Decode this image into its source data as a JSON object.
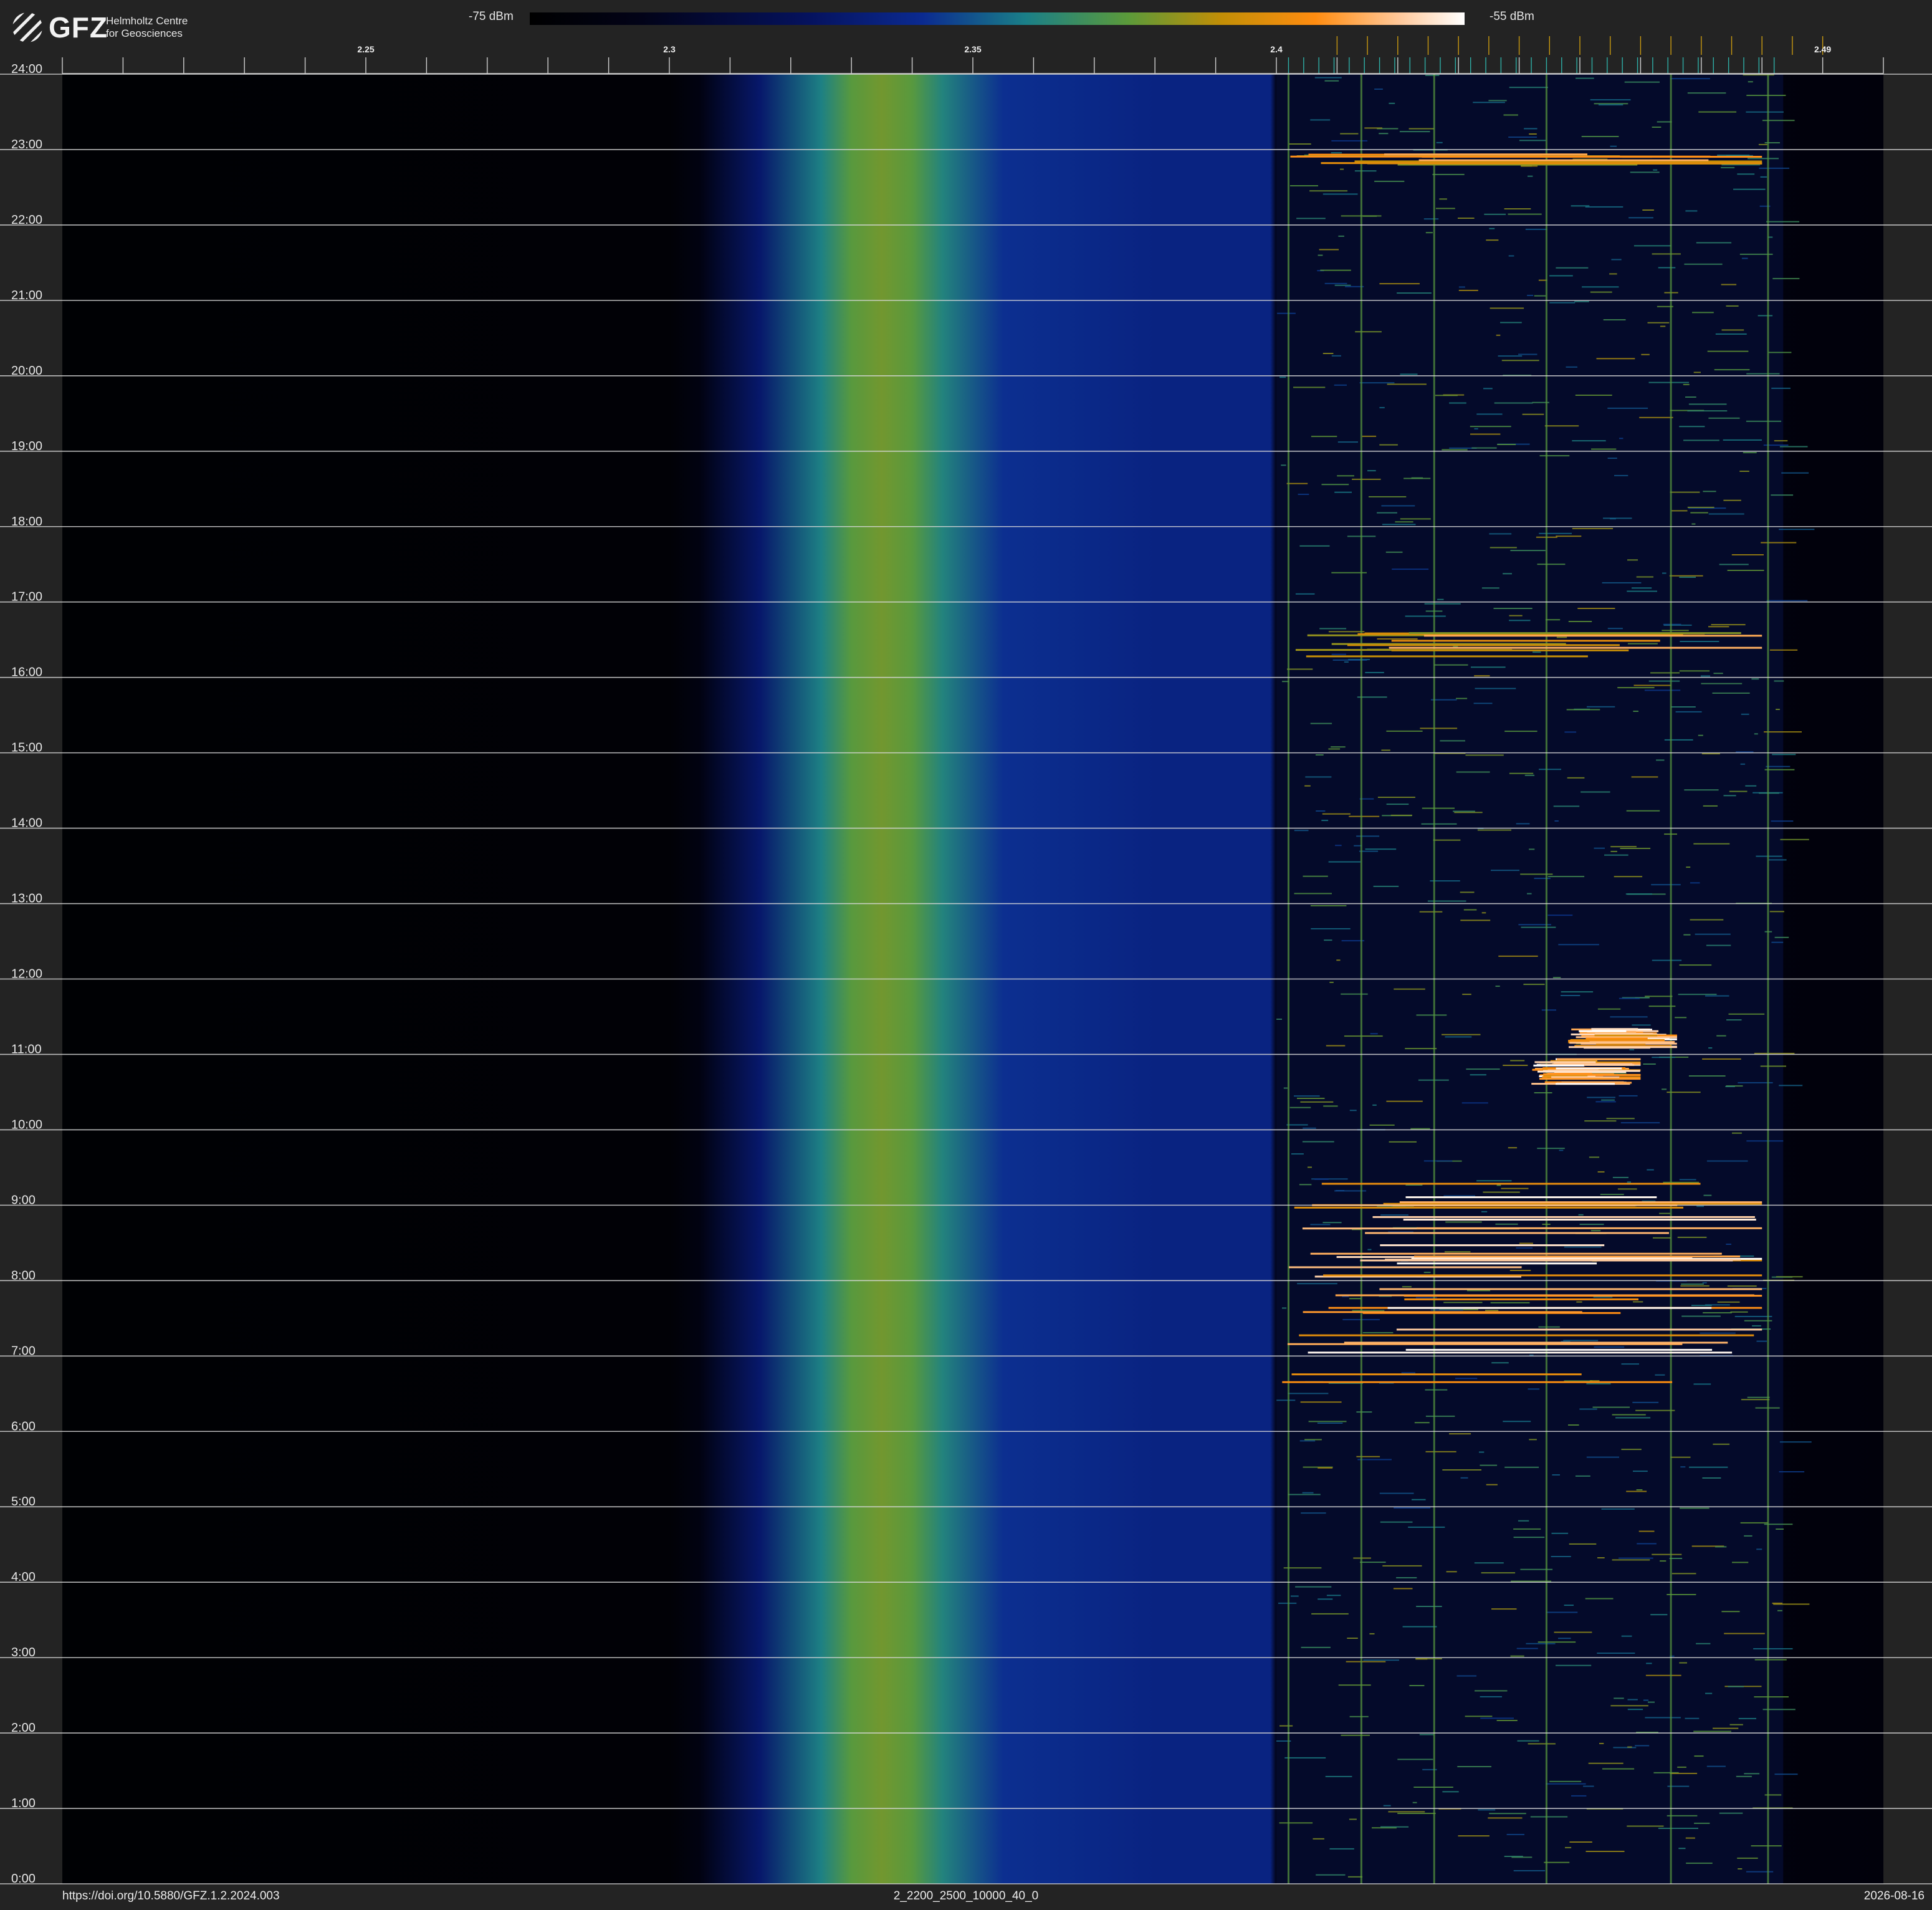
{
  "logo": {
    "text": "GFZ",
    "subtitle_line1": "Helmholtz Centre",
    "subtitle_line2": "for Geosciences"
  },
  "colorbar": {
    "min_label": "-75 dBm",
    "max_label": "-55 dBm",
    "colors": [
      "#000000",
      "#020318",
      "#05125e",
      "#0b2a90",
      "#1a7f88",
      "#5b9a3a",
      "#c28e06",
      "#ff8c10",
      "#ffc89a",
      "#ffffff"
    ]
  },
  "footer": {
    "doi": "https://doi.org/10.5880/GFZ.1.2.2024.003",
    "code": "2_2200_2500_10000_40_0",
    "date": "2026-08-16"
  },
  "chart_data": {
    "type": "heatmap",
    "x_unit": "GHz",
    "xlim": [
      2.2,
      2.5
    ],
    "ylim": [
      0,
      24
    ],
    "x_ticks": [
      2.25,
      2.3,
      2.35,
      2.4,
      2.49
    ],
    "x_tick_labels": [
      "2.25",
      "2.3",
      "2.35",
      "2.4",
      "2.49"
    ],
    "y_ticks": [
      0,
      1,
      2,
      3,
      4,
      5,
      6,
      7,
      8,
      9,
      10,
      11,
      12,
      13,
      14,
      15,
      16,
      17,
      18,
      19,
      20,
      21,
      22,
      23,
      24
    ],
    "y_tick_labels": [
      "0:00",
      "1:00",
      "2:00",
      "3:00",
      "4:00",
      "5:00",
      "6:00",
      "7:00",
      "8:00",
      "9:00",
      "10:00",
      "11:00",
      "12:00",
      "13:00",
      "14:00",
      "15:00",
      "16:00",
      "17:00",
      "18:00",
      "19:00",
      "20:00",
      "21:00",
      "22:00",
      "23:00",
      "24:00"
    ],
    "grid": true,
    "value_range_dbm": [
      -75,
      -55
    ],
    "spectral_profile": [
      {
        "x": 2.2,
        "level": 0.02
      },
      {
        "x": 2.3,
        "level": 0.03
      },
      {
        "x": 2.305,
        "level": 0.08
      },
      {
        "x": 2.315,
        "level": 0.25
      },
      {
        "x": 2.325,
        "level": 0.45
      },
      {
        "x": 2.33,
        "level": 0.55
      },
      {
        "x": 2.335,
        "level": 0.58
      },
      {
        "x": 2.34,
        "level": 0.55
      },
      {
        "x": 2.345,
        "level": 0.46
      },
      {
        "x": 2.355,
        "level": 0.34
      },
      {
        "x": 2.38,
        "level": 0.3
      },
      {
        "x": 2.399,
        "level": 0.3
      },
      {
        "x": 2.4,
        "level": 0.1
      },
      {
        "x": 2.5,
        "level": 0.05
      }
    ],
    "ism_band": {
      "x_start": 2.4,
      "x_end": 2.4835
    },
    "events": [
      {
        "t_start": 6.6,
        "t_end": 9.3,
        "x_start": 2.4,
        "x_end": 2.48,
        "intensity": "high"
      },
      {
        "t_start": 10.6,
        "t_end": 10.95,
        "x_start": 2.442,
        "x_end": 2.46,
        "intensity": "high"
      },
      {
        "t_start": 11.1,
        "t_end": 11.35,
        "x_start": 2.448,
        "x_end": 2.466,
        "intensity": "high"
      },
      {
        "t_start": 16.2,
        "t_end": 16.6,
        "x_start": 2.402,
        "x_end": 2.48,
        "intensity": "medium"
      },
      {
        "t_start": 22.8,
        "t_end": 22.95,
        "x_start": 2.402,
        "x_end": 2.48,
        "intensity": "medium"
      }
    ]
  }
}
